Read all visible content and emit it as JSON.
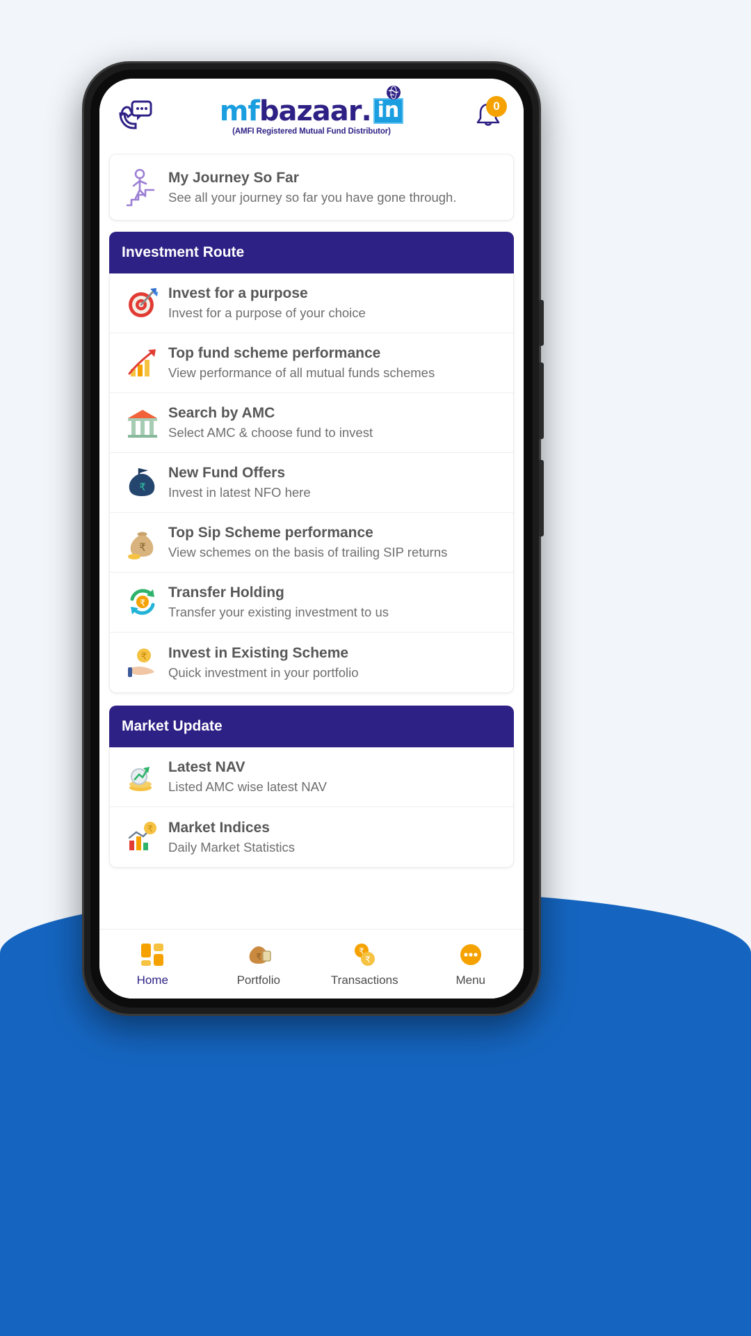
{
  "header": {
    "support_icon": "phone-chat-icon",
    "logo": {
      "part1": "mf",
      "part2": "bazaar",
      "dot": ".",
      "tld": "in",
      "globe_icon": "globe-icon",
      "tagline": "(AMFI Registered Mutual Fund Distributor)"
    },
    "notification": {
      "icon": "bell-icon",
      "badge_count": "0",
      "badge_color": "#f5a201"
    }
  },
  "journey_card": {
    "icon": "person-climbing-stairs-icon",
    "title": "My Journey So Far",
    "subtitle": "See all your journey so far you have gone through."
  },
  "sections": [
    {
      "heading": "Investment Route",
      "heading_color": "#2e2185",
      "items": [
        {
          "icon": "target-dart-icon",
          "title": "Invest for a purpose",
          "subtitle": "Invest for a purpose of your choice"
        },
        {
          "icon": "growth-chart-icon",
          "title": "Top fund scheme performance",
          "subtitle": "View performance of all mutual funds schemes"
        },
        {
          "icon": "bank-building-icon",
          "title": "Search by AMC",
          "subtitle": "Select AMC & choose fund to invest"
        },
        {
          "icon": "money-bag-flag-icon",
          "title": "New Fund Offers",
          "subtitle": "Invest in latest NFO here"
        },
        {
          "icon": "rupee-money-bag-icon",
          "title": "Top Sip Scheme performance",
          "subtitle": "View schemes on the basis of trailing SIP returns"
        },
        {
          "icon": "transfer-arrows-rupee-icon",
          "title": "Transfer Holding",
          "subtitle": "Transfer your existing investment to us"
        },
        {
          "icon": "hand-rupee-coin-icon",
          "title": "Invest in Existing Scheme",
          "subtitle": "Quick investment in your portfolio"
        }
      ]
    },
    {
      "heading": "Market Update",
      "heading_color": "#2e2185",
      "items": [
        {
          "icon": "nav-coins-chart-icon",
          "title": "Latest NAV",
          "subtitle": "Listed AMC wise latest NAV"
        },
        {
          "icon": "bar-chart-rupee-icon",
          "title": "Market Indices",
          "subtitle": "Daily Market Statistics"
        }
      ]
    }
  ],
  "bottom_nav": {
    "items": [
      {
        "icon": "grid-squares-icon",
        "label": "Home",
        "active": true
      },
      {
        "icon": "portfolio-bag-icon",
        "label": "Portfolio",
        "active": false
      },
      {
        "icon": "transactions-rupee-icon",
        "label": "Transactions",
        "active": false
      },
      {
        "icon": "menu-dots-icon",
        "label": "Menu",
        "active": false
      }
    ]
  },
  "theme": {
    "brand_purple": "#2e2185",
    "brand_blue": "#1a9ee0",
    "page_blue": "#1565c0",
    "accent_orange": "#f5a201"
  }
}
